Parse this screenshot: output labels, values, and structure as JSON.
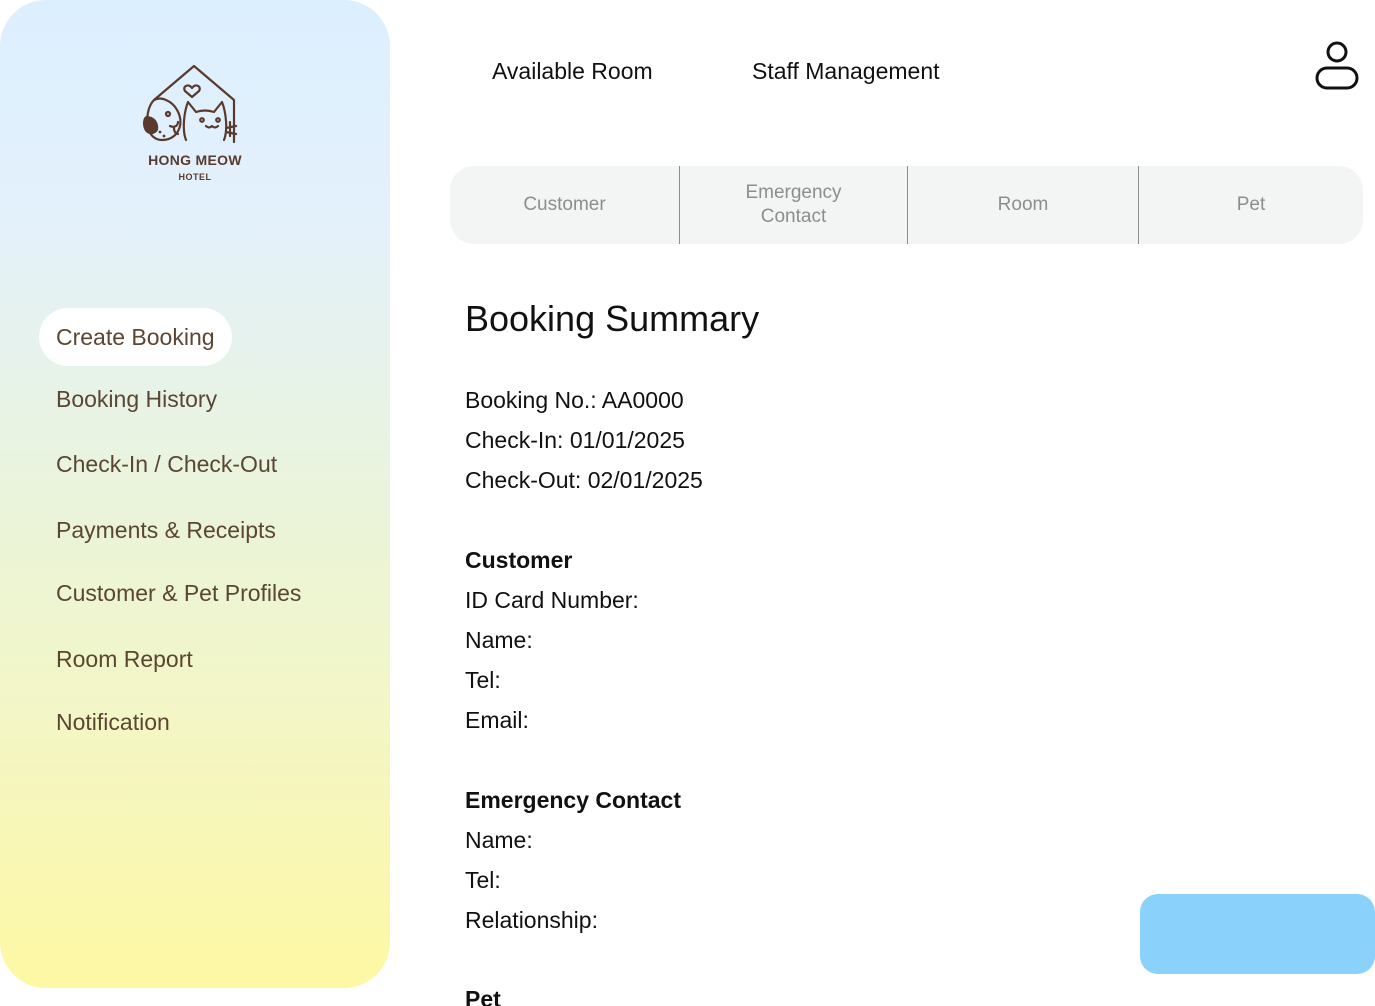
{
  "brand": {
    "name": "HONG MEOW",
    "sub": "HOTEL"
  },
  "sidebar": {
    "items": [
      {
        "label": "Create Booking"
      },
      {
        "label": "Booking History"
      },
      {
        "label": "Check-In / Check-Out"
      },
      {
        "label": "Payments & Receipts"
      },
      {
        "label": "Customer & Pet Profiles"
      },
      {
        "label": "Room Report"
      },
      {
        "label": "Notification"
      }
    ],
    "active": "Create Booking"
  },
  "topnav": {
    "available_room": "Available Room",
    "staff_management": "Staff Management"
  },
  "tabs": [
    {
      "line1": "Customer",
      "line2": ""
    },
    {
      "line1": "Emergency",
      "line2": "Contact"
    },
    {
      "line1": "Room",
      "line2": ""
    },
    {
      "line1": "Pet",
      "line2": ""
    }
  ],
  "summary": {
    "title": "Booking Summary",
    "booking_no": "Booking No.: AA0000",
    "check_in": "Check-In: 01/01/2025",
    "check_out": "Check-Out: 02/01/2025",
    "customer": {
      "heading": "Customer",
      "id_card": "ID Card Number:",
      "name": "Name:",
      "tel": "Tel:",
      "email": "Email:"
    },
    "emergency": {
      "heading": "Emergency Contact",
      "name": "Name:",
      "tel": "Tel:",
      "relationship": "Relationship:"
    },
    "pet": {
      "heading": "Pet"
    }
  },
  "colors": {
    "accent_button": "#8ad1fb",
    "sidebar_text": "#5a4632",
    "tab_bg": "#f2f5f4",
    "tab_text": "#8a8f8c"
  },
  "icons": {
    "logo": "hotel-logo-icon",
    "user": "user-profile-icon"
  }
}
